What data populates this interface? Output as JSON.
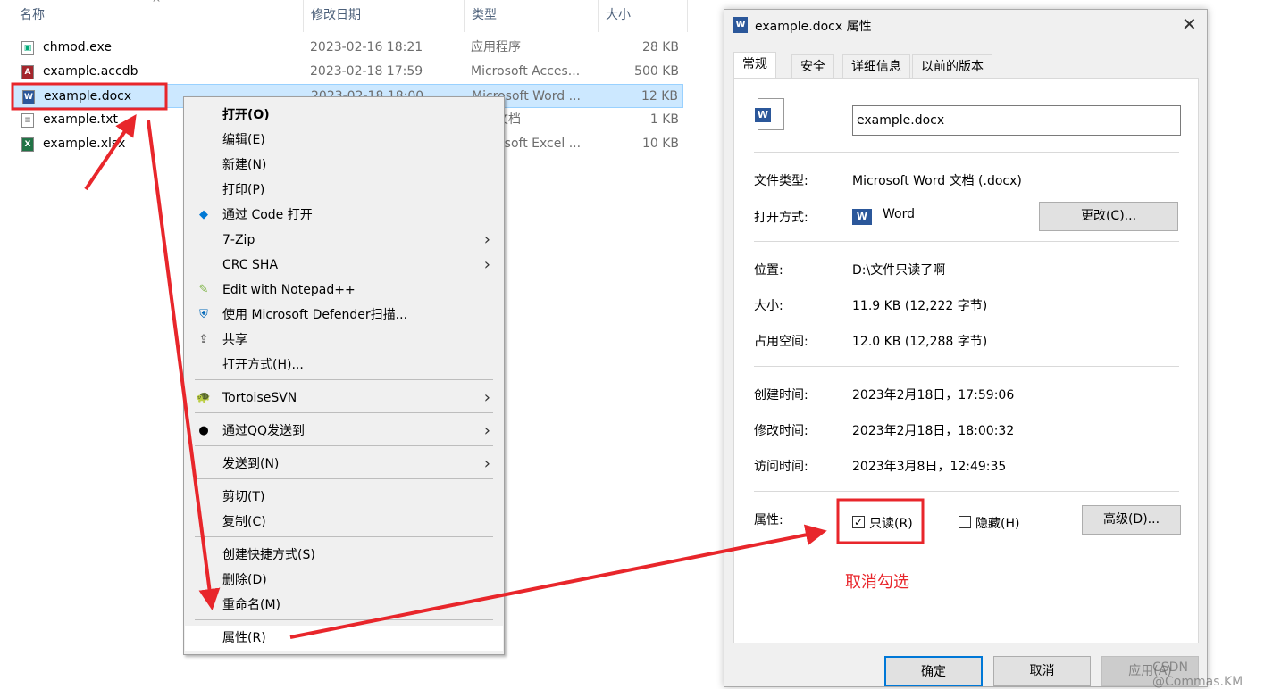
{
  "explorer": {
    "columns": [
      "名称",
      "修改日期",
      "类型",
      "大小"
    ],
    "files": [
      {
        "name": "chmod.exe",
        "date": "2023-02-16 18:21",
        "type": "应用程序",
        "size": "28 KB",
        "icon": "exe-icon"
      },
      {
        "name": "example.accdb",
        "date": "2023-02-18 17:59",
        "type": "Microsoft Acces...",
        "size": "500 KB",
        "icon": "access-icon"
      },
      {
        "name": "example.docx",
        "date": "2023-02-18 18:00",
        "type": "Microsoft Word ...",
        "size": "12 KB",
        "icon": "word-icon",
        "selected": true
      },
      {
        "name": "example.txt",
        "date": "",
        "type": "文本文档",
        "size": "1 KB",
        "icon": "text-icon"
      },
      {
        "name": "example.xlsx",
        "date": "",
        "type": "Microsoft Excel ...",
        "size": "10 KB",
        "icon": "excel-icon"
      }
    ]
  },
  "context_menu": {
    "items": [
      {
        "label": "打开(O)",
        "bold": true
      },
      {
        "label": "编辑(E)"
      },
      {
        "label": "新建(N)"
      },
      {
        "label": "打印(P)"
      },
      {
        "label": "通过 Code 打开",
        "icon": "vscode-icon"
      },
      {
        "label": "7-Zip",
        "submenu": true
      },
      {
        "label": "CRC SHA",
        "submenu": true
      },
      {
        "label": "Edit with Notepad++",
        "icon": "notepadpp-icon"
      },
      {
        "label": "使用 Microsoft Defender扫描...",
        "icon": "defender-icon"
      },
      {
        "label": "共享",
        "icon": "share-icon"
      },
      {
        "label": "打开方式(H)..."
      },
      {
        "label": "TortoiseSVN",
        "submenu": true,
        "icon": "tortoisesvn-icon"
      },
      {
        "label": "通过QQ发送到",
        "submenu": true,
        "icon": "qq-icon"
      },
      {
        "label": "发送到(N)",
        "submenu": true
      },
      {
        "label": "剪切(T)"
      },
      {
        "label": "复制(C)"
      },
      {
        "label": "创建快捷方式(S)"
      },
      {
        "label": "删除(D)"
      },
      {
        "label": "重命名(M)"
      },
      {
        "label": "属性(R)",
        "highlighted": true
      }
    ]
  },
  "dialog": {
    "title": "example.docx 属性",
    "tabs": [
      "常规",
      "安全",
      "详细信息",
      "以前的版本"
    ],
    "active_tab": "常规",
    "filename": "example.docx",
    "file_type_label": "文件类型:",
    "file_type": "Microsoft Word 文档 (.docx)",
    "open_with_label": "打开方式:",
    "open_with": "Word",
    "change_button": "更改(C)...",
    "location_label": "位置:",
    "location": "D:\\文件只读了啊",
    "size_label": "大小:",
    "size": "11.9 KB (12,222 字节)",
    "disk_size_label": "占用空间:",
    "disk_size": "12.0 KB (12,288 字节)",
    "created_label": "创建时间:",
    "created": "2023年2月18日，17:59:06",
    "modified_label": "修改时间:",
    "modified": "2023年2月18日，18:00:32",
    "accessed_label": "访问时间:",
    "accessed": "2023年3月8日，12:49:35",
    "attributes_label": "属性:",
    "readonly_label": "只读(R)",
    "readonly_checked": true,
    "hidden_label": "隐藏(H)",
    "hidden_checked": false,
    "advanced_button": "高级(D)...",
    "ok_button": "确定",
    "cancel_button": "取消",
    "apply_button": "应用(A)"
  },
  "annotation": {
    "text": "取消勾选",
    "color": "#e8262b"
  },
  "watermark": "CSDN @Commas.KM"
}
